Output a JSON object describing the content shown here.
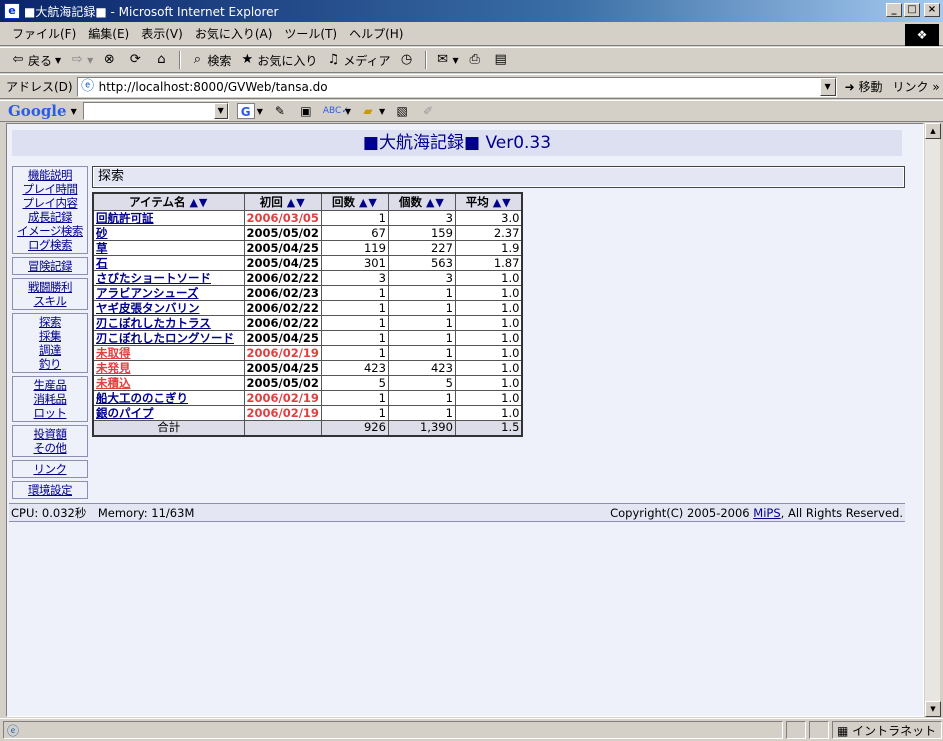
{
  "window": {
    "title": "■大航海記録■ - Microsoft Internet Explorer",
    "app_icon": "ie-icon"
  },
  "menu": [
    "ファイル(F)",
    "編集(E)",
    "表示(V)",
    "お気に入り(A)",
    "ツール(T)",
    "ヘルプ(H)"
  ],
  "toolbar": {
    "back": "戻る",
    "search": "検索",
    "favorites": "お気に入り",
    "media": "メディア"
  },
  "address": {
    "label": "アドレス(D)",
    "url": "http://localhost:8000/GVWeb/tansa.do",
    "go": "移動",
    "links": "リンク"
  },
  "googlebar": {
    "logo": "Google"
  },
  "page": {
    "banner": "■大航海記録■ Ver0.33",
    "nav_groups": [
      [
        "機能説明",
        "プレイ時間",
        "プレイ内容",
        "成長記録",
        "イメージ検索",
        "ログ検索"
      ],
      [
        "冒険記録"
      ],
      [
        "戦闘勝利",
        "スキル"
      ],
      [
        "探索",
        "採集",
        "調達",
        "釣り"
      ],
      [
        "生産品",
        "消耗品",
        "ロット"
      ],
      [
        "投資額",
        "その他"
      ],
      [
        "リンク"
      ],
      [
        "環境設定"
      ]
    ],
    "section_title": "探索",
    "table": {
      "headers": [
        "アイテム名",
        "初回",
        "回数",
        "個数",
        "平均"
      ],
      "sort_arrows": "▲▼",
      "rows": [
        {
          "name": "回航許可証",
          "date": "2006/03/05",
          "count": "1",
          "qty": "3",
          "avg": "3.0",
          "name_red": false,
          "date_red": true
        },
        {
          "name": "砂",
          "date": "2005/05/02",
          "count": "67",
          "qty": "159",
          "avg": "2.37",
          "name_red": false,
          "date_red": false
        },
        {
          "name": "草",
          "date": "2005/04/25",
          "count": "119",
          "qty": "227",
          "avg": "1.9",
          "name_red": false,
          "date_red": false
        },
        {
          "name": "石",
          "date": "2005/04/25",
          "count": "301",
          "qty": "563",
          "avg": "1.87",
          "name_red": false,
          "date_red": false
        },
        {
          "name": "さびたショートソード",
          "date": "2006/02/22",
          "count": "3",
          "qty": "3",
          "avg": "1.0",
          "name_red": false,
          "date_red": false
        },
        {
          "name": "アラビアンシューズ",
          "date": "2006/02/23",
          "count": "1",
          "qty": "1",
          "avg": "1.0",
          "name_red": false,
          "date_red": false
        },
        {
          "name": "ヤギ皮張タンバリン",
          "date": "2006/02/22",
          "count": "1",
          "qty": "1",
          "avg": "1.0",
          "name_red": false,
          "date_red": false
        },
        {
          "name": "刃こぼれしたカトラス",
          "date": "2006/02/22",
          "count": "1",
          "qty": "1",
          "avg": "1.0",
          "name_red": false,
          "date_red": false
        },
        {
          "name": "刃こぼれしたロングソード",
          "date": "2005/04/25",
          "count": "1",
          "qty": "1",
          "avg": "1.0",
          "name_red": false,
          "date_red": false
        },
        {
          "name": "未取得",
          "date": "2006/02/19",
          "count": "1",
          "qty": "1",
          "avg": "1.0",
          "name_red": true,
          "date_red": true
        },
        {
          "name": "未発見",
          "date": "2005/04/25",
          "count": "423",
          "qty": "423",
          "avg": "1.0",
          "name_red": true,
          "date_red": false
        },
        {
          "name": "未積込",
          "date": "2005/05/02",
          "count": "5",
          "qty": "5",
          "avg": "1.0",
          "name_red": true,
          "date_red": false
        },
        {
          "name": "船大工ののこぎり",
          "date": "2006/02/19",
          "count": "1",
          "qty": "1",
          "avg": "1.0",
          "name_red": false,
          "date_red": true
        },
        {
          "name": "銀のパイプ",
          "date": "2006/02/19",
          "count": "1",
          "qty": "1",
          "avg": "1.0",
          "name_red": false,
          "date_red": true
        }
      ],
      "total": {
        "label": "合計",
        "count": "926",
        "qty": "1,390",
        "avg": "1.5"
      }
    },
    "footer": {
      "stats": "CPU: 0.032秒　Memory: 11/63M",
      "copyright_pre": "Copyright(C) 2005-2006",
      "copyright_link": "MiPS",
      "copyright_post": ", All Rights Reserved."
    }
  },
  "statusbar": {
    "zone": "イントラネット"
  },
  "colors": {
    "link": "#00008b",
    "red": "#e04040",
    "page_bg": "#eef0fa"
  }
}
